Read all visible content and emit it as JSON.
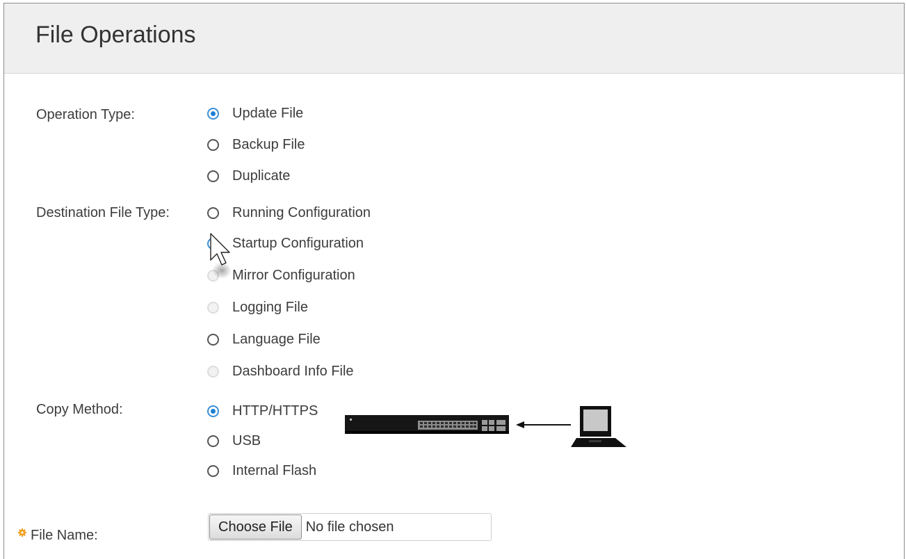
{
  "page": {
    "title": "File Operations"
  },
  "operation_type": {
    "label": "Operation Type:",
    "options": [
      {
        "label": "Update File",
        "checked": true,
        "disabled": false
      },
      {
        "label": "Backup File",
        "checked": false,
        "disabled": false
      },
      {
        "label": "Duplicate",
        "checked": false,
        "disabled": false
      }
    ]
  },
  "destination_file_type": {
    "label": "Destination File Type:",
    "options": [
      {
        "label": "Running Configuration",
        "checked": false,
        "disabled": false
      },
      {
        "label": "Startup Configuration",
        "checked": true,
        "disabled": false
      },
      {
        "label": "Mirror Configuration",
        "checked": false,
        "disabled": true
      },
      {
        "label": "Logging File",
        "checked": false,
        "disabled": true
      },
      {
        "label": "Language File",
        "checked": false,
        "disabled": false
      },
      {
        "label": "Dashboard Info File",
        "checked": false,
        "disabled": true
      }
    ]
  },
  "copy_method": {
    "label": "Copy Method:",
    "options": [
      {
        "label": "HTTP/HTTPS",
        "checked": true,
        "disabled": false
      },
      {
        "label": "USB",
        "checked": false,
        "disabled": false
      },
      {
        "label": "Internal Flash",
        "checked": false,
        "disabled": false
      }
    ],
    "illustration_icons": [
      "network-switch-icon",
      "arrow-left-icon",
      "laptop-icon"
    ]
  },
  "file_name": {
    "label": "File Name:",
    "required_icon": "required-gear-icon",
    "button_label": "Choose File",
    "status_text": "No file chosen"
  },
  "colors": {
    "accent": "#1e7fd4",
    "header_bg": "#efefef",
    "required": "#f0a020",
    "text": "#3c3c3c"
  }
}
